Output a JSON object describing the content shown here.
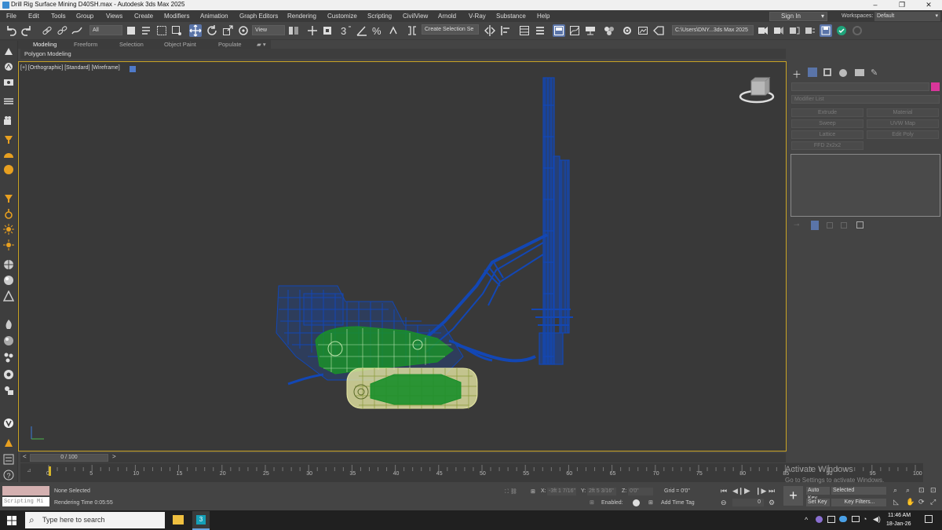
{
  "window": {
    "title": "Drill Rig Surface Mining D40SH.max - Autodesk 3ds Max 2025",
    "controls": [
      "–",
      "❐",
      "✕"
    ]
  },
  "menu": [
    "File",
    "Edit",
    "Tools",
    "Group",
    "Views",
    "Create",
    "Modifiers",
    "Animation",
    "Graph Editors",
    "Rendering",
    "Customize",
    "Scripting",
    "CivilView",
    "Arnold",
    "V-Ray",
    "Substance",
    "Help"
  ],
  "account": {
    "signin": "Sign In",
    "workspaces_label": "Workspaces:",
    "workspace": "Default"
  },
  "toolbar": {
    "filter": "All",
    "refcoord": "View",
    "selection_set": "Create Selection Se",
    "project_path": "C:\\Users\\DNY...3ds Max 2025"
  },
  "ribbon": {
    "tabs": [
      "Modeling",
      "Freeform",
      "Selection",
      "Object Paint",
      "Populate"
    ],
    "active": "Modeling",
    "sub": "Polygon Modeling"
  },
  "viewport": {
    "label": "[+] [Orthographic] [Standard] [Wireframe]"
  },
  "command_panel": {
    "modifier_list": "Modifier List",
    "buttons": [
      "Extrude",
      "Material",
      "Sweep",
      "UVW Map",
      "Lattice",
      "Edit Poly",
      "FFD 2x2x2"
    ]
  },
  "time": {
    "slider": "0 / 100",
    "ticks": [
      "0",
      "5",
      "10",
      "15",
      "20",
      "25",
      "30",
      "35",
      "40",
      "45",
      "50",
      "55",
      "60",
      "65",
      "70",
      "75",
      "80",
      "85",
      "90",
      "95",
      "100"
    ]
  },
  "status": {
    "script_placeholder": "Scripting Mi",
    "selection": "None Selected",
    "render_time": "Rendering Time 0:05:55",
    "x_label": "X:",
    "x": "-3ft 1 7/16\"",
    "y_label": "Y:",
    "y": "2ft 5 3/16\"",
    "z_label": "Z:",
    "z": "0'0\"",
    "grid": "Grid = 0'0\"",
    "enabled": "Enabled:",
    "add_time_tag": "Add Time Tag",
    "auto_key": "Auto Key",
    "set_key": "Set Key",
    "selected": "Selected",
    "key_filters": "Key Filters...",
    "frame": "0"
  },
  "watermark": {
    "line1": "Activate Windows",
    "line2": "Go to Settings to activate Windows."
  },
  "taskbar": {
    "search": "Type here to search",
    "time": "11:46 AM",
    "date": "18-Jan-26"
  },
  "colors": {
    "wire_blue": "#1347b4",
    "wire_green": "#1a8f2a",
    "wire_yellow": "#e6e7a4",
    "accent": "#d8369a",
    "border": "#c9a324"
  }
}
